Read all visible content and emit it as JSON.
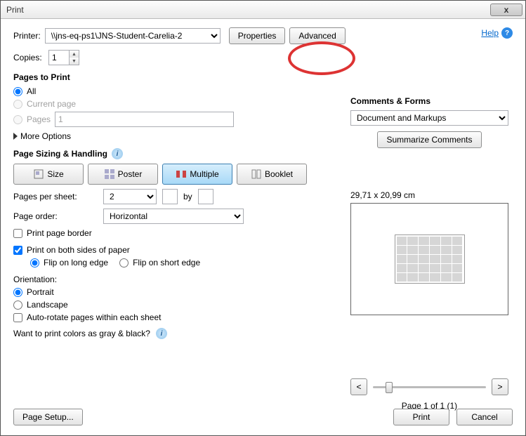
{
  "window": {
    "title": "Print",
    "close": "x"
  },
  "help": {
    "label": "Help"
  },
  "printer": {
    "label": "Printer:",
    "selected": "\\\\jns-eq-ps1\\JNS-Student-Carelia-2",
    "properties_btn": "Properties",
    "advanced_btn": "Advanced"
  },
  "copies": {
    "label": "Copies:",
    "value": "1"
  },
  "pages_to_print": {
    "title": "Pages to Print",
    "all": "All",
    "current": "Current page",
    "pages_label": "Pages",
    "pages_value": "1",
    "more_options": "More Options"
  },
  "sizing": {
    "title": "Page Sizing & Handling",
    "size": "Size",
    "poster": "Poster",
    "multiple": "Multiple",
    "booklet": "Booklet"
  },
  "pages_per_sheet": {
    "label": "Pages per sheet:",
    "selected": "2",
    "by": "by"
  },
  "page_order": {
    "label": "Page order:",
    "selected": "Horizontal"
  },
  "print_page_border": "Print page border",
  "duplex": {
    "label": "Print on both sides of paper",
    "long_edge": "Flip on long edge",
    "short_edge": "Flip on short edge"
  },
  "orientation": {
    "title": "Orientation:",
    "portrait": "Portrait",
    "landscape": "Landscape",
    "auto_rotate": "Auto-rotate pages within each sheet"
  },
  "grayscale_hint": "Want to print colors as gray & black?",
  "comments_forms": {
    "title": "Comments & Forms",
    "selected": "Document and Markups",
    "summarize_btn": "Summarize Comments"
  },
  "preview": {
    "dimensions": "29,71 x 20,99 cm",
    "page_indicator": "Page 1 of 1 (1)",
    "prev": "<",
    "next": ">"
  },
  "footer": {
    "page_setup": "Page Setup...",
    "print": "Print",
    "cancel": "Cancel"
  }
}
